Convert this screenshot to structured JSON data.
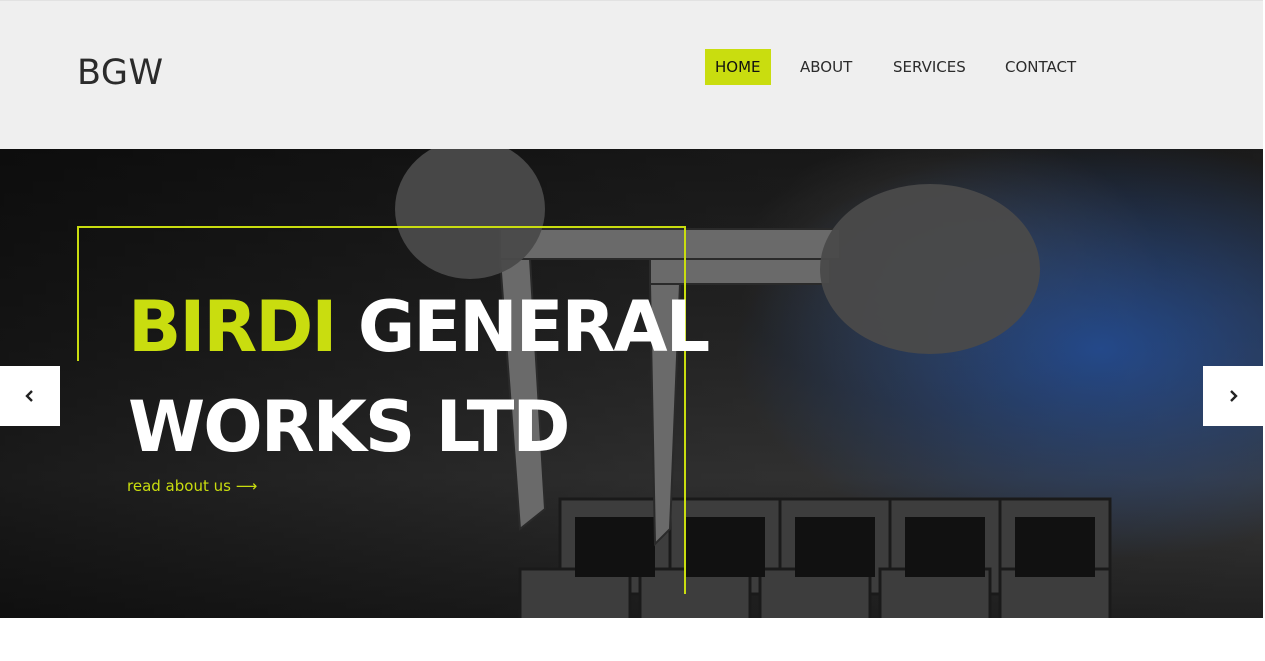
{
  "header": {
    "logo": "BGW",
    "nav": [
      {
        "label": "HOME",
        "active": true
      },
      {
        "label": "ABOUT",
        "active": false
      },
      {
        "label": "SERVICES",
        "active": false
      },
      {
        "label": "CONTACT",
        "active": false
      }
    ]
  },
  "hero": {
    "headline_accent": "BIRDI",
    "headline_rest": "GENERAL WORKS LTD",
    "link_text": "read about us",
    "link_arrow": "⟶",
    "prev_icon": "chevron-left-icon",
    "next_icon": "chevron-right-icon"
  },
  "colors": {
    "accent": "#c9dd0f",
    "header_bg": "#efefef",
    "text_dark": "#2b2b2b"
  }
}
